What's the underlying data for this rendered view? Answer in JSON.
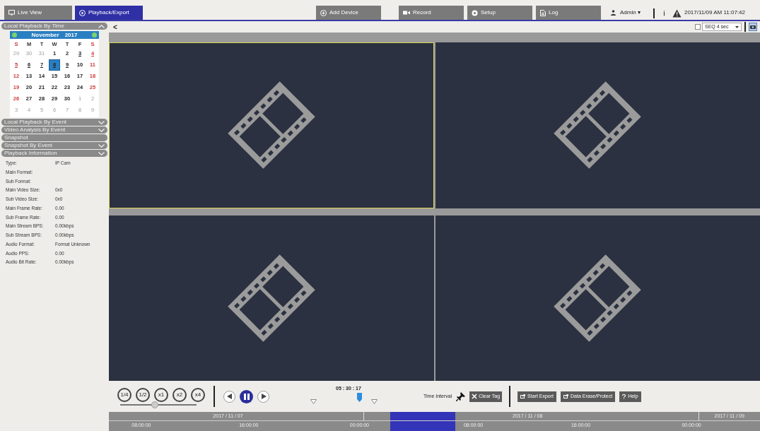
{
  "top_tabs": [
    {
      "label": "Live View",
      "kind": "monitor",
      "selected": false
    },
    {
      "label": "Playback/Export",
      "kind": "play",
      "selected": true
    },
    {
      "label": "Add Device",
      "kind": "plus",
      "selected": false
    },
    {
      "label": "Record",
      "kind": "camera",
      "selected": false
    },
    {
      "label": "Setup",
      "kind": "gear",
      "selected": false
    },
    {
      "label": "Log",
      "kind": "doc",
      "selected": false
    }
  ],
  "user": {
    "label": "Admin",
    "caret": "▾",
    "info": "i",
    "datetime": "2017/11/09 AM 11:07:42"
  },
  "toolbar": {
    "back": "<",
    "seq_checked": false,
    "seq_value": "SEQ 4 sec"
  },
  "sidebar": {
    "sections": [
      {
        "title": "Local Playback By Time",
        "expanded": true
      },
      {
        "title": "Local Playback By Event",
        "expanded": false
      },
      {
        "title": "Video Analysis By Event",
        "expanded": false
      },
      {
        "title": "Snapshot"
      },
      {
        "title": "Snapshot By Event",
        "expanded": false
      },
      {
        "title": "Playback Information",
        "expanded": false
      }
    ],
    "calendar": {
      "month": "November",
      "year": "2017",
      "weekdays": [
        "S",
        "M",
        "T",
        "W",
        "T",
        "F",
        "S"
      ],
      "days": [
        {
          "label": "29",
          "kind": "other",
          "marked": false,
          "selected": false
        },
        {
          "label": "30",
          "kind": "other",
          "marked": false,
          "selected": false
        },
        {
          "label": "31",
          "kind": "other",
          "marked": false,
          "selected": false
        },
        {
          "label": "1",
          "kind": "weekday",
          "marked": false,
          "selected": false
        },
        {
          "label": "2",
          "kind": "weekday",
          "marked": false,
          "selected": false
        },
        {
          "label": "3",
          "kind": "weekday",
          "marked": true,
          "selected": false
        },
        {
          "label": "4",
          "kind": "weekend",
          "marked": true,
          "selected": false
        },
        {
          "label": "5",
          "kind": "weekend",
          "marked": true,
          "selected": false
        },
        {
          "label": "6",
          "kind": "weekday",
          "marked": true,
          "selected": false
        },
        {
          "label": "7",
          "kind": "weekday",
          "marked": true,
          "selected": false
        },
        {
          "label": "8",
          "kind": "weekday",
          "marked": true,
          "selected": true
        },
        {
          "label": "9",
          "kind": "weekday",
          "marked": true,
          "selected": false
        },
        {
          "label": "10",
          "kind": "weekday",
          "marked": false,
          "selected": false
        },
        {
          "label": "11",
          "kind": "weekend",
          "marked": false,
          "selected": false
        },
        {
          "label": "12",
          "kind": "weekend",
          "marked": false,
          "selected": false
        },
        {
          "label": "13",
          "kind": "weekday",
          "marked": false,
          "selected": false
        },
        {
          "label": "14",
          "kind": "weekday",
          "marked": false,
          "selected": false
        },
        {
          "label": "15",
          "kind": "weekday",
          "marked": false,
          "selected": false
        },
        {
          "label": "16",
          "kind": "weekday",
          "marked": false,
          "selected": false
        },
        {
          "label": "17",
          "kind": "weekday",
          "marked": false,
          "selected": false
        },
        {
          "label": "18",
          "kind": "weekend",
          "marked": false,
          "selected": false
        },
        {
          "label": "19",
          "kind": "weekend",
          "marked": false,
          "selected": false
        },
        {
          "label": "20",
          "kind": "weekday",
          "marked": false,
          "selected": false
        },
        {
          "label": "21",
          "kind": "weekday",
          "marked": false,
          "selected": false
        },
        {
          "label": "22",
          "kind": "weekday",
          "marked": false,
          "selected": false
        },
        {
          "label": "23",
          "kind": "weekday",
          "marked": false,
          "selected": false
        },
        {
          "label": "24",
          "kind": "weekday",
          "marked": false,
          "selected": false
        },
        {
          "label": "25",
          "kind": "weekend",
          "marked": false,
          "selected": false
        },
        {
          "label": "26",
          "kind": "weekend",
          "marked": false,
          "selected": false
        },
        {
          "label": "27",
          "kind": "weekday",
          "marked": false,
          "selected": false
        },
        {
          "label": "28",
          "kind": "weekday",
          "marked": false,
          "selected": false
        },
        {
          "label": "29",
          "kind": "weekday",
          "marked": false,
          "selected": false
        },
        {
          "label": "30",
          "kind": "weekday",
          "marked": false,
          "selected": false
        },
        {
          "label": "1",
          "kind": "other",
          "marked": false,
          "selected": false
        },
        {
          "label": "2",
          "kind": "other",
          "marked": false,
          "selected": false
        },
        {
          "label": "3",
          "kind": "other",
          "marked": false,
          "selected": false
        },
        {
          "label": "4",
          "kind": "other",
          "marked": false,
          "selected": false
        },
        {
          "label": "5",
          "kind": "other",
          "marked": false,
          "selected": false
        },
        {
          "label": "6",
          "kind": "other",
          "marked": false,
          "selected": false
        },
        {
          "label": "7",
          "kind": "other",
          "marked": false,
          "selected": false
        },
        {
          "label": "8",
          "kind": "other",
          "marked": false,
          "selected": false
        },
        {
          "label": "9",
          "kind": "other",
          "marked": false,
          "selected": false
        }
      ]
    },
    "info": [
      {
        "label": "Type:",
        "value": "IP Cam"
      },
      {
        "label": "Main Format:"
      },
      {
        "label": "Sub Format:"
      },
      {
        "label": "Main Video Size:",
        "value": "0x0"
      },
      {
        "label": "Sub Video Size:",
        "value": "0x0"
      },
      {
        "label": "Main Frame Rate:",
        "value": "0.00"
      },
      {
        "label": "Sub Frame Rate:",
        "value": "0.00"
      },
      {
        "label": "Main Stream BPS:",
        "value": "0.00kbps"
      },
      {
        "label": "Sub Stream BPS:",
        "value": "0.00kbps"
      },
      {
        "label": "Audio Format:",
        "value": "Format Unknown"
      },
      {
        "label": "Audio PPS:",
        "value": "0.00"
      },
      {
        "label": "Audio Bit Rate:",
        "value": "0.00kbps"
      }
    ]
  },
  "tiles": [
    {
      "selected": true
    },
    {
      "selected": false
    },
    {
      "selected": false
    },
    {
      "selected": false
    }
  ],
  "controls": {
    "speeds": [
      "1/4",
      "1/2",
      "x1",
      "x2",
      "x4"
    ],
    "speed_slider": {
      "level": 0.45
    },
    "playing": true,
    "time": "05 : 30 : 17",
    "time_interval": "Time Interval",
    "clear_tag": "Clear Tag",
    "buttons": [
      {
        "label": "Start Export",
        "kind": "export"
      },
      {
        "label": "Data Erase/Protect",
        "kind": "export"
      },
      {
        "label": "Help",
        "kind": "help"
      }
    ]
  },
  "timeline": {
    "dates": [
      "2017 / 11 / 07",
      "2017 / 11 / 08",
      "2017 / 11 / 09"
    ],
    "times": [
      "08:00:00",
      "16:00:00",
      "00:00:00",
      "08:00:00",
      "16:00:00",
      "00:00:00"
    ]
  }
}
